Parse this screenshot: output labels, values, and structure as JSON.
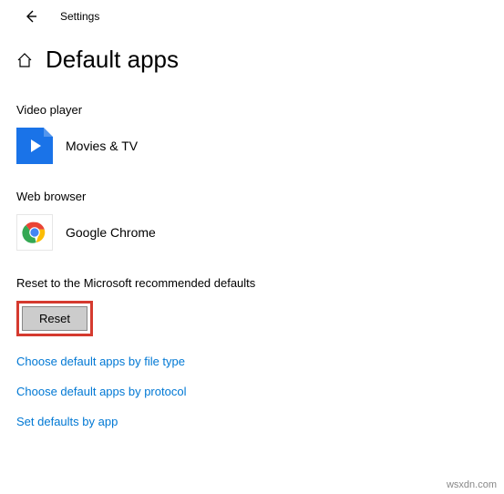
{
  "topbar": {
    "label": "Settings"
  },
  "header": {
    "title": "Default apps"
  },
  "sections": {
    "video": {
      "label": "Video player",
      "app": "Movies & TV"
    },
    "browser": {
      "label": "Web browser",
      "app": "Google Chrome"
    }
  },
  "reset": {
    "desc": "Reset to the Microsoft recommended defaults",
    "button": "Reset",
    "highlight_color": "#d53a2f"
  },
  "links": {
    "by_file_type": "Choose default apps by file type",
    "by_protocol": "Choose default apps by protocol",
    "by_app": "Set defaults by app"
  },
  "watermark": "wsxdn.com"
}
